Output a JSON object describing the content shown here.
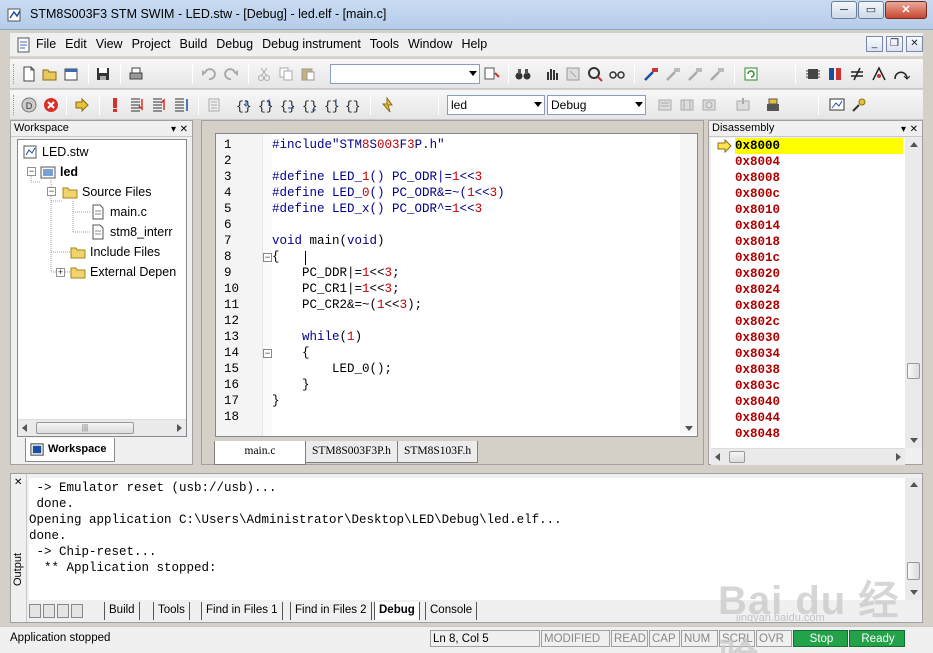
{
  "window": {
    "title": "STM8S003F3 STM SWIM - LED.stw - [Debug] - led.elf - [main.c]",
    "controls": {
      "minimize": "─",
      "restore": "▭",
      "close": "✕"
    }
  },
  "menubar": {
    "items": [
      "File",
      "Edit",
      "View",
      "Project",
      "Build",
      "Debug",
      "Debug instrument",
      "Tools",
      "Window",
      "Help"
    ],
    "mdi_controls": {
      "minimize": "_",
      "restore": "❐",
      "close": "✕"
    }
  },
  "toolbar": {
    "search_combo_value": "",
    "project_combo_value": "led",
    "config_combo_value": "Debug"
  },
  "workspace": {
    "header": "Workspace",
    "header_controls": {
      "pin": "▾",
      "close": "✕"
    },
    "tree": [
      {
        "label": "LED.stw"
      },
      {
        "label": "led"
      },
      {
        "label": "Source Files"
      },
      {
        "label": "main.c"
      },
      {
        "label": "stm8_interr"
      },
      {
        "label": "Include Files"
      },
      {
        "label": "External Depen"
      }
    ],
    "scroll_grip": "|||",
    "tab_label": "Workspace"
  },
  "editor": {
    "lines": [
      {
        "n": "1",
        "code": "#include\"STM8S003F3P.h\""
      },
      {
        "n": "2",
        "code": ""
      },
      {
        "n": "3",
        "code": "#define LED_1() PC_ODR|=1<<3"
      },
      {
        "n": "4",
        "code": "#define LED_0() PC_ODR&=~(1<<3)"
      },
      {
        "n": "5",
        "code": "#define LED_x() PC_ODR^=1<<3"
      },
      {
        "n": "6",
        "code": ""
      },
      {
        "n": "7",
        "code": "void main(void)"
      },
      {
        "n": "8",
        "code": "{"
      },
      {
        "n": "9",
        "code": "    PC_DDR|=1<<3;"
      },
      {
        "n": "10",
        "code": "    PC_CR1|=1<<3;"
      },
      {
        "n": "11",
        "code": "    PC_CR2&=~(1<<3);"
      },
      {
        "n": "12",
        "code": ""
      },
      {
        "n": "13",
        "code": "    while(1)"
      },
      {
        "n": "14",
        "code": "    {"
      },
      {
        "n": "15",
        "code": "        LED_0();"
      },
      {
        "n": "16",
        "code": "    }"
      },
      {
        "n": "17",
        "code": "}"
      },
      {
        "n": "18",
        "code": ""
      }
    ],
    "tabs": [
      "main.c",
      "STM8S003F3P.h",
      "STM8S103F.h"
    ],
    "active_tab": "main.c"
  },
  "disassembly": {
    "header": "Disassembly",
    "header_controls": {
      "pin": "▾",
      "close": "✕"
    },
    "addresses": [
      "0x8000",
      "0x8004",
      "0x8008",
      "0x800c",
      "0x8010",
      "0x8014",
      "0x8018",
      "0x801c",
      "0x8020",
      "0x8024",
      "0x8028",
      "0x802c",
      "0x8030",
      "0x8034",
      "0x8038",
      "0x803c",
      "0x8040",
      "0x8044",
      "0x8048"
    ],
    "current_address": "0x8000"
  },
  "output": {
    "side_label": "Output",
    "side_close": "✕",
    "lines": [
      " -> Emulator reset (usb://usb)...",
      " done.",
      "Opening application C:\\Users\\Administrator\\Desktop\\LED\\Debug\\led.elf...",
      "done.",
      " -> Chip-reset...",
      "  ** Application stopped:"
    ],
    "tabs": [
      "Build",
      "Tools",
      "Find in Files 1",
      "Find in Files 2",
      "Debug",
      "Console"
    ],
    "active_tab": "Debug"
  },
  "statusbar": {
    "message": "Application stopped",
    "position": "Ln 8, Col 5",
    "modified": "MODIFIED",
    "read": "READ",
    "cap": "CAP",
    "num": "NUM",
    "scrl": "SCRL",
    "ovr": "OVR",
    "stop": "Stop",
    "ready": "Ready"
  },
  "watermark": {
    "brand": "Bai du 经验",
    "url": "jingyan.baidu.com"
  },
  "colors": {
    "keyword": "#00008b",
    "number": "#c00000",
    "disasm_address": "#b00000",
    "current_line_highlight": "#ffff00",
    "status_green": "#22a34a"
  }
}
